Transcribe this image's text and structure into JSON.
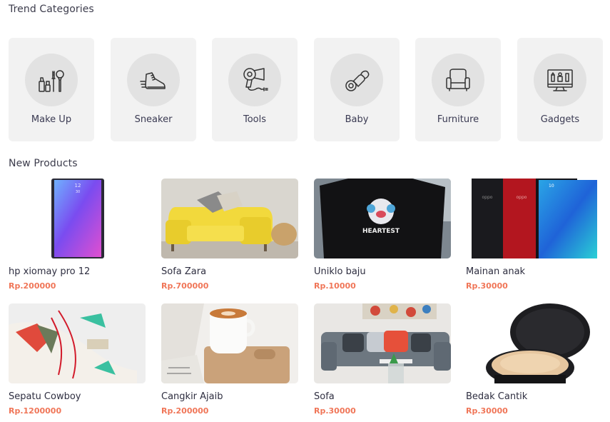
{
  "trend_section": {
    "title": "Trend Categories"
  },
  "categories": [
    {
      "label": "Make Up",
      "icon": "makeup-icon"
    },
    {
      "label": "Sneaker",
      "icon": "sneaker-icon"
    },
    {
      "label": "Tools",
      "icon": "hair-dryer-icon"
    },
    {
      "label": "Baby",
      "icon": "pacifier-icon"
    },
    {
      "label": "Furniture",
      "icon": "armchair-icon"
    },
    {
      "label": "Gadgets",
      "icon": "monitor-icon"
    }
  ],
  "new_section": {
    "title": "New Products"
  },
  "products": [
    {
      "name": "hp xiomay pro 12",
      "price": "Rp.200000"
    },
    {
      "name": "Sofa Zara",
      "price": "Rp.700000"
    },
    {
      "name": "Uniklo baju",
      "price": "Rp.10000"
    },
    {
      "name": "Mainan anak",
      "price": "Rp.30000"
    },
    {
      "name": "Sepatu Cowboy",
      "price": "Rp.1200000"
    },
    {
      "name": "Cangkir Ajaib",
      "price": "Rp.200000"
    },
    {
      "name": "Sofa",
      "price": "Rp.30000"
    },
    {
      "name": "Bedak Cantik",
      "price": "Rp.30000"
    }
  ],
  "colors": {
    "price": "#f07658",
    "card_bg": "#f2f2f2",
    "icon_circle": "#e2e2e2"
  }
}
